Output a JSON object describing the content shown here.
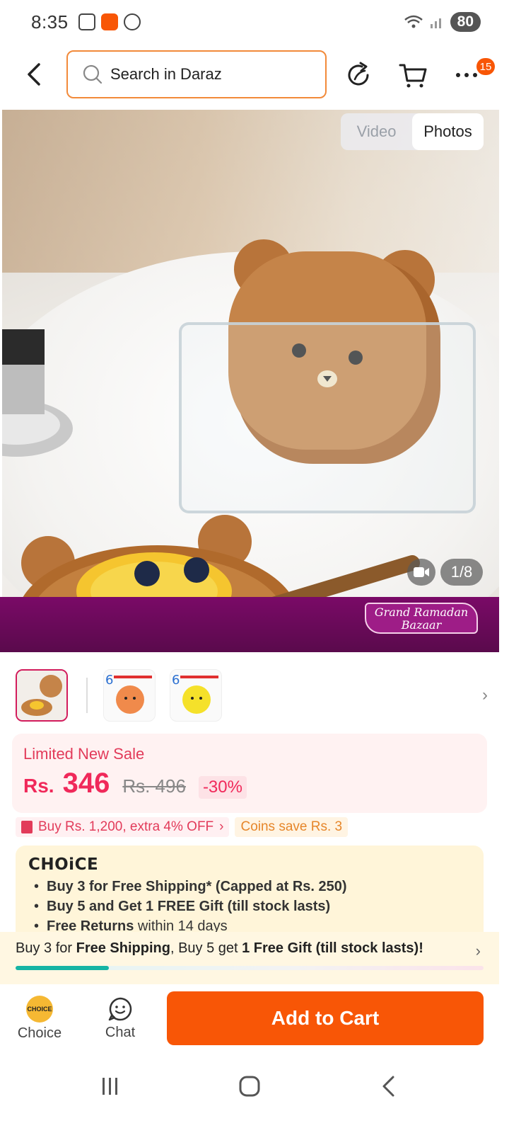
{
  "status_bar": {
    "time": "8:35",
    "battery": "80"
  },
  "search": {
    "placeholder": "Search in Daraz"
  },
  "topnav": {
    "more_badge": "15"
  },
  "gallery": {
    "video_label": "Video",
    "photos_label": "Photos",
    "counter": "1/8"
  },
  "promo": {
    "line1": "Grand Ramadan",
    "line2": "Bazaar"
  },
  "price": {
    "label": "Limited New Sale",
    "currency": "Rs.",
    "amount": "346",
    "original": "Rs. 496",
    "discount": "-30%"
  },
  "chips": {
    "voucher": "Buy Rs. 1,200, extra 4% OFF",
    "coins": "Coins save Rs. 3"
  },
  "choice": {
    "logo": "CHOiCE",
    "items": [
      {
        "bold": "Buy 3 for  Free Shipping* (Capped at Rs. 250)",
        "rest": ""
      },
      {
        "bold": "Buy 5 and Get 1 FREE Gift (till stock lasts)",
        "rest": ""
      },
      {
        "bold": "Free Returns",
        "rest": " within 14 days"
      }
    ]
  },
  "shipping_bar": {
    "t1": "Buy 3 for ",
    "b1": "Free Shipping",
    "t2": ", Buy 5 get ",
    "b2": "1 Free Gift (till stock lasts)!",
    "progress": 0.2
  },
  "actions": {
    "choice_icon_text": "CHOICE",
    "choice_label": "Choice",
    "chat_label": "Chat",
    "add_to_cart": "Add to Cart"
  },
  "colors": {
    "brand_orange": "#f85606",
    "price_pink": "#f0295a",
    "promo_purple": "#6a0a5a",
    "progress_teal": "#16b4a4"
  }
}
